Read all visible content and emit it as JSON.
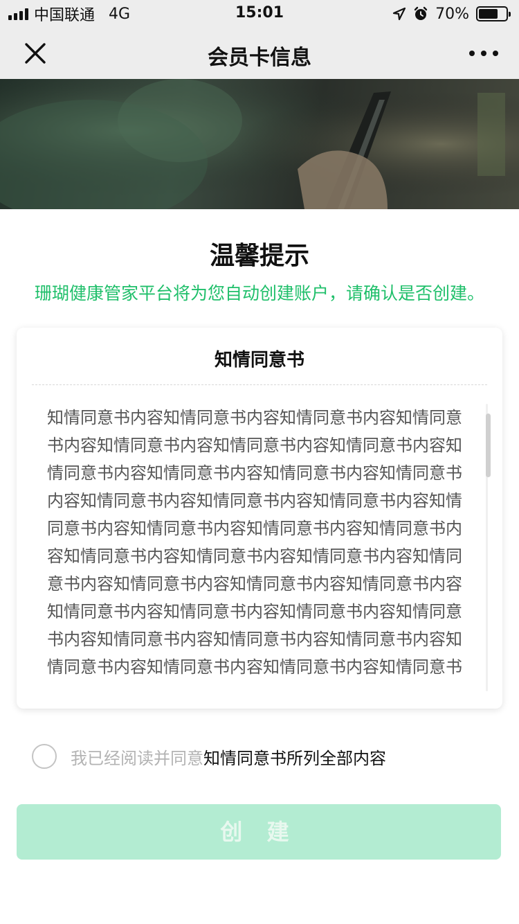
{
  "status_bar": {
    "carrier": "中国联通",
    "network": "4G",
    "time": "15:01",
    "battery_percent": "70%",
    "battery_level": 0.7
  },
  "nav": {
    "title": "会员卡信息"
  },
  "tip": {
    "title": "温馨提示",
    "subtitle": "珊瑚健康管家平台将为您自动创建账户，请确认是否创建。"
  },
  "consent": {
    "title": "知情同意书",
    "body": "知情同意书内容知情同意书内容知情同意书内容知情同意书内容知情同意书内容知情同意书内容知情同意书内容知情同意书内容知情同意书内容知情同意书内容知情同意书内容知情同意书内容知情同意书内容知情同意书内容知情同意书内容知情同意书内容知情同意书内容知情同意书内容知情同意书内容知情同意书内容知情同意书内容知情同意书内容知情同意书内容知情同意书内容知情同意书内容知情同意书内容知情同意书内容知情同意书内容知情同意书内容知情同意书内容知情同意书内容知情同意书内容知情同意书内容知情同意书内容知情同意书内容知情同意书内容知情同意书内容知情同意书内容知情同意书内容知情同意书内容知情同意书内容知情同意书内容知情同意书内容知情同意书内容知情同意书内容知情同意书内容知情同意书内容知情同意书内容知情同意书内容知情同意书"
  },
  "agreement": {
    "prefix": "我已经阅读并同意",
    "link": "知情同意书所列全部内容",
    "checked": false
  },
  "create_button": {
    "label": "创 建",
    "enabled": false
  },
  "colors": {
    "accent_green": "#1fbf6a",
    "button_disabled": "#b3ecd2",
    "nav_background": "#ededed"
  },
  "icons": [
    "signal-icon",
    "location-arrow-icon",
    "alarm-icon",
    "battery-icon",
    "close-icon",
    "more-icon",
    "radio-unchecked-icon"
  ]
}
